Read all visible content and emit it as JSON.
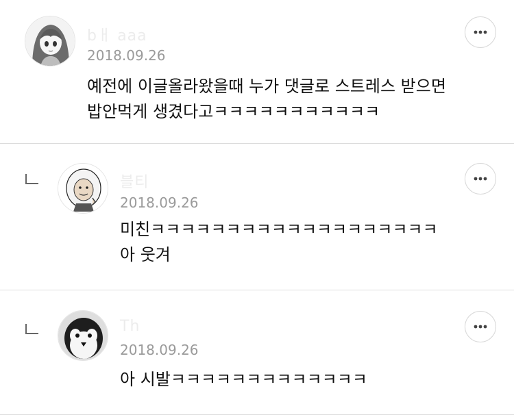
{
  "comments": [
    {
      "username": "bㅐ          aaa",
      "date": "2018.09.26",
      "lines": [
        "예전에 이글올라왔을때 누가 댓글로 스트레스 받으면",
        "밥안먹게 생겼다고ㅋㅋㅋㅋㅋㅋㅋㅋㅋㅋㅋ"
      ],
      "avatar_icon": "anime-girl-avatar",
      "is_reply": false
    },
    {
      "username": "블티     ",
      "date": "2018.09.26",
      "lines": [
        "미친ㅋㅋㅋㅋㅋㅋㅋㅋㅋㅋㅋㅋㅋㅋㅋㅋㅋㅋㅋ",
        "아 웃겨"
      ],
      "avatar_icon": "cartoon-character-avatar",
      "is_reply": true
    },
    {
      "username": "Th      ",
      "date": "2018.09.26",
      "lines": [
        "아 시발ㅋㅋㅋㅋㅋㅋㅋㅋㅋㅋㅋㅋㅋ"
      ],
      "avatar_icon": "penguin-avatar",
      "is_reply": true
    }
  ],
  "icons": {
    "more": "more-options-icon",
    "reply": "reply-arrow-icon"
  }
}
